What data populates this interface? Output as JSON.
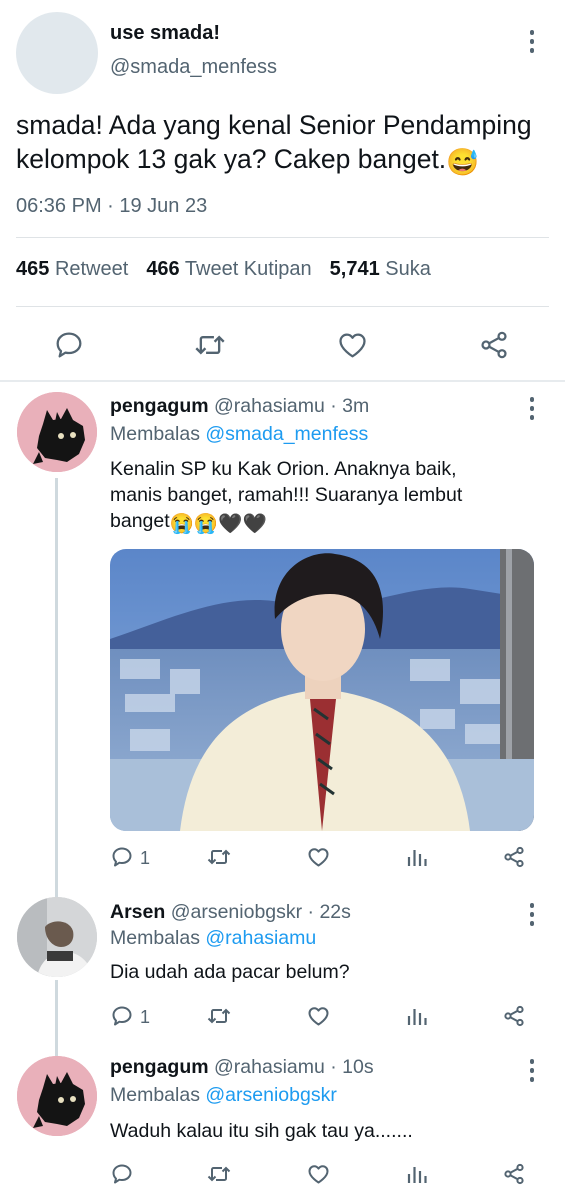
{
  "main_tweet": {
    "display_name": "use smada!",
    "handle": "@smada_menfess",
    "text": "smada! Ada yang kenal Senior Pendamping kelompok 13 gak ya? Cakep banget.",
    "emoji": "😅",
    "timestamp": "06:36 PM · 19 Jun 23",
    "stats": [
      {
        "count": "465",
        "label": "Retweet"
      },
      {
        "count": "466",
        "label": "Tweet Kutipan"
      },
      {
        "count": "5,741",
        "label": "Suka"
      }
    ],
    "actions": [
      "reply-icon",
      "retweet-icon",
      "like-icon",
      "share-icon"
    ]
  },
  "replies": [
    {
      "name": "pengagum",
      "meta": "@rahasiamu · 3m",
      "replying_label": "Membalas",
      "replying_to": "@smada_menfess",
      "text_line1": "Kenalin SP ku Kak Orion. Anaknya baik,",
      "text_line2": "manis banget, ramah!!! Suaranya lembut",
      "text_line3": "banget",
      "text_emoji": "😭😭🖤🖤",
      "reply_count": "1",
      "has_media": true
    },
    {
      "name": "Arsen",
      "meta": "@arseniobgskr · 22s",
      "replying_label": "Membalas",
      "replying_to": "@rahasiamu",
      "text": "Dia udah ada pacar belum?",
      "reply_count": "1"
    },
    {
      "name": "pengagum",
      "meta": "@rahasiamu · 10s",
      "replying_label": "Membalas",
      "replying_to": "@arseniobgskr",
      "text": "Waduh kalau itu sih gak tau ya.......",
      "reply_count": ""
    }
  ],
  "colors": {
    "text": "#0f1419",
    "secondary": "#536471",
    "link": "#1d9bf0",
    "divider": "#dfe3e6"
  }
}
